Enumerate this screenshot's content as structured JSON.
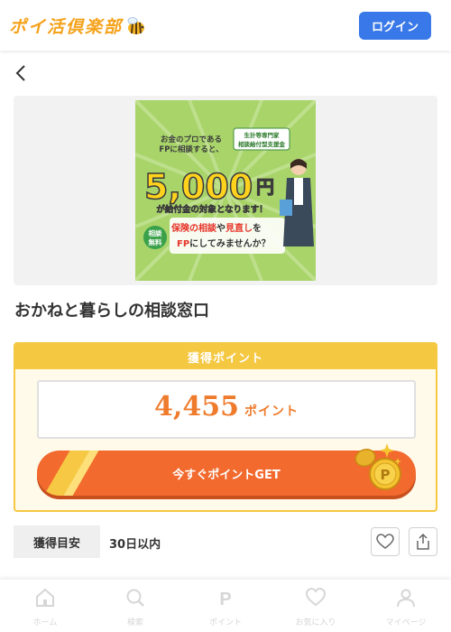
{
  "header": {
    "logo_text": "ポイ活倶楽部",
    "login_label": "ログイン"
  },
  "banner": {
    "line1": "お金のプロである",
    "line2": "FPに相談すると、",
    "badge1": "生計等専門家",
    "badge2": "相談給付型支援金",
    "amount": "5,000",
    "amount_unit": "円",
    "subline": "が給付金の対象となります！",
    "badge_left1": "相談",
    "badge_left2": "無料",
    "cta1a": "保険の相談",
    "cta1b": "や",
    "cta1c": "見直し",
    "cta1d": "を",
    "cta2a": "FP",
    "cta2b": "にしてみませんか？"
  },
  "offer": {
    "title": "おかねと暮らしの相談窓口"
  },
  "points": {
    "header": "獲得ポイント",
    "value": "4,455",
    "unit": "ポイント",
    "get_label": "今すぐポイントGET"
  },
  "estimate": {
    "label": "獲得目安",
    "value": "30日以内"
  },
  "bottom_nav": [
    {
      "label": "ホーム",
      "icon": "home-icon"
    },
    {
      "label": "検索",
      "icon": "search-icon"
    },
    {
      "label": "ポイント",
      "icon": "point-icon"
    },
    {
      "label": "お気に入り",
      "icon": "heart-icon"
    },
    {
      "label": "マイページ",
      "icon": "person-icon"
    }
  ],
  "colors": {
    "accent_blue": "#3878e8",
    "point_orange": "#ef7b2c",
    "card_yellow": "#f5c842",
    "get_button": "#f26a2e"
  }
}
